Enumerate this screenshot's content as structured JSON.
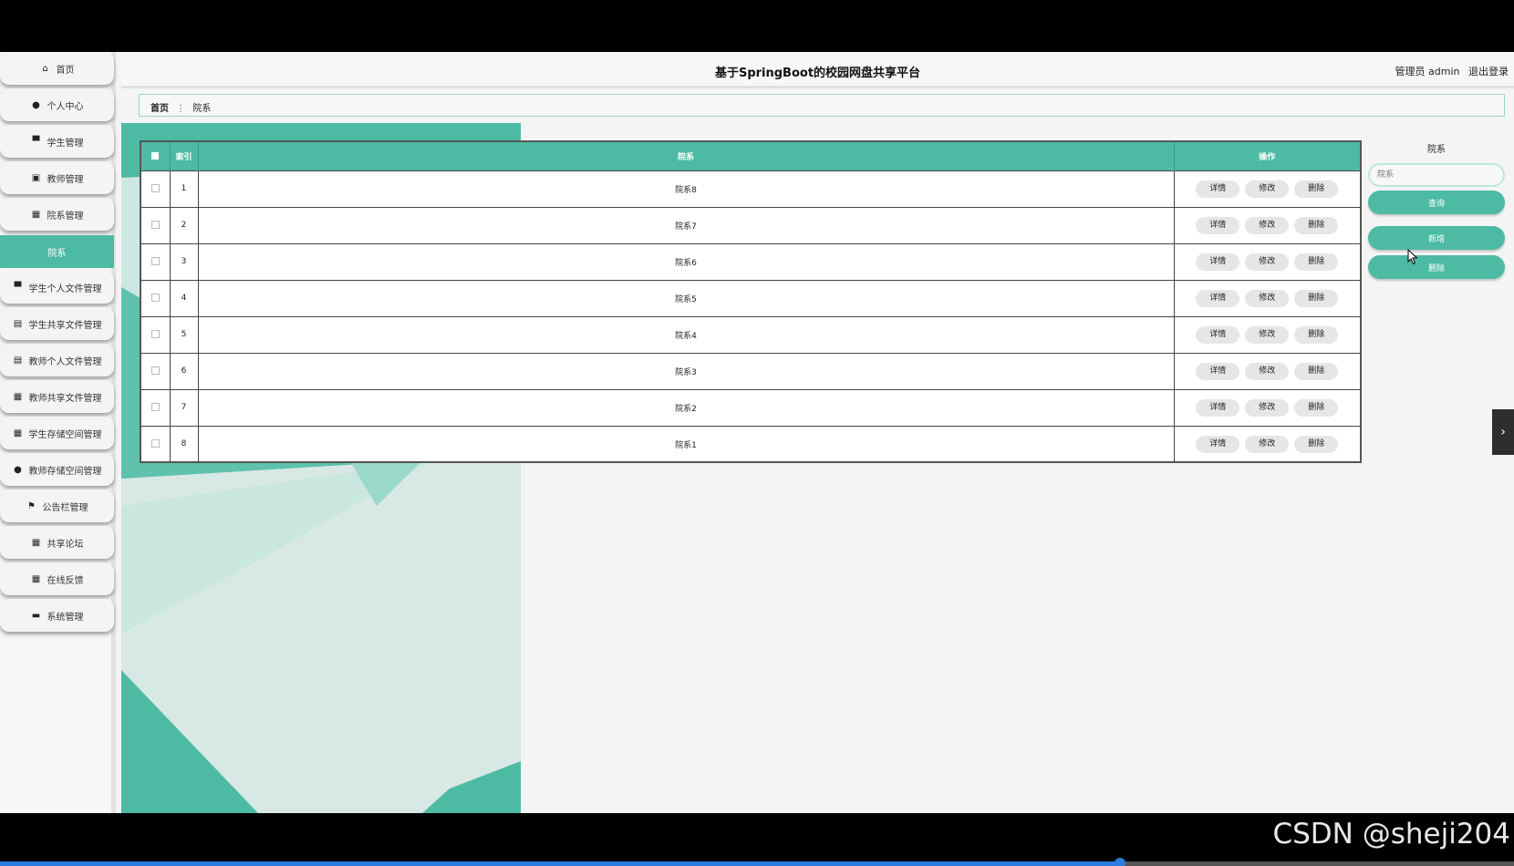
{
  "app": {
    "title": "基于SpringBoot的校园网盘共享平台",
    "user_role": "管理员 admin",
    "logout": "退出登录"
  },
  "sidebar": {
    "items": [
      {
        "label": "首页",
        "icon": "home-icon",
        "glyph": "⌂",
        "active": false
      },
      {
        "label": "个人中心",
        "icon": "user-icon",
        "glyph": "●",
        "active": false
      },
      {
        "label": "学生管理",
        "icon": "monitor-icon",
        "glyph": "▀",
        "active": false
      },
      {
        "label": "教师管理",
        "icon": "chart-icon",
        "glyph": "▣",
        "active": false
      },
      {
        "label": "院系管理",
        "icon": "grid-icon",
        "glyph": "▦",
        "active": false
      },
      {
        "label": "院系",
        "icon": "",
        "glyph": "",
        "active": true
      },
      {
        "label": "学生个人文件管理",
        "icon": "monitor-icon",
        "glyph": "▀",
        "active": false
      },
      {
        "label": "学生共享文件管理",
        "icon": "clipboard-icon",
        "glyph": "▤",
        "active": false
      },
      {
        "label": "教师个人文件管理",
        "icon": "clipboard-check-icon",
        "glyph": "▤",
        "active": false
      },
      {
        "label": "教师共享文件管理",
        "icon": "grid-icon",
        "glyph": "▦",
        "active": false
      },
      {
        "label": "学生存储空间管理",
        "icon": "grid-icon",
        "glyph": "▦",
        "active": false
      },
      {
        "label": "教师存储空间管理",
        "icon": "pin-icon",
        "glyph": "●",
        "active": false
      },
      {
        "label": "公告栏管理",
        "icon": "flag-icon",
        "glyph": "⚑",
        "active": false
      },
      {
        "label": "共享论坛",
        "icon": "grid-icon",
        "glyph": "▦",
        "active": false
      },
      {
        "label": "在线反馈",
        "icon": "grid-icon",
        "glyph": "▦",
        "active": false
      },
      {
        "label": "系统管理",
        "icon": "briefcase-icon",
        "glyph": "▬",
        "active": false
      }
    ]
  },
  "breadcrumb": {
    "home": "首页",
    "separator": "⋮",
    "current": "院系"
  },
  "table": {
    "headers": {
      "index": "索引",
      "name": "院系",
      "actions": "操作"
    },
    "rows": [
      {
        "index": "1",
        "name": "院系8"
      },
      {
        "index": "2",
        "name": "院系7"
      },
      {
        "index": "3",
        "name": "院系6"
      },
      {
        "index": "4",
        "name": "院系5"
      },
      {
        "index": "5",
        "name": "院系4"
      },
      {
        "index": "6",
        "name": "院系3"
      },
      {
        "index": "7",
        "name": "院系2"
      },
      {
        "index": "8",
        "name": "院系1"
      }
    ],
    "actions": {
      "detail": "详情",
      "edit": "修改",
      "delete": "删除"
    }
  },
  "search_panel": {
    "label": "院系",
    "placeholder": "院系",
    "query_button": "查询",
    "add_button": "新增",
    "delete_button": "删除"
  },
  "watermark": "CSDN @sheji204",
  "video_progress": 0.74,
  "colors": {
    "accent": "#4dbba4",
    "accent_dark": "#3a9a86",
    "progress": "#2b7be0"
  }
}
